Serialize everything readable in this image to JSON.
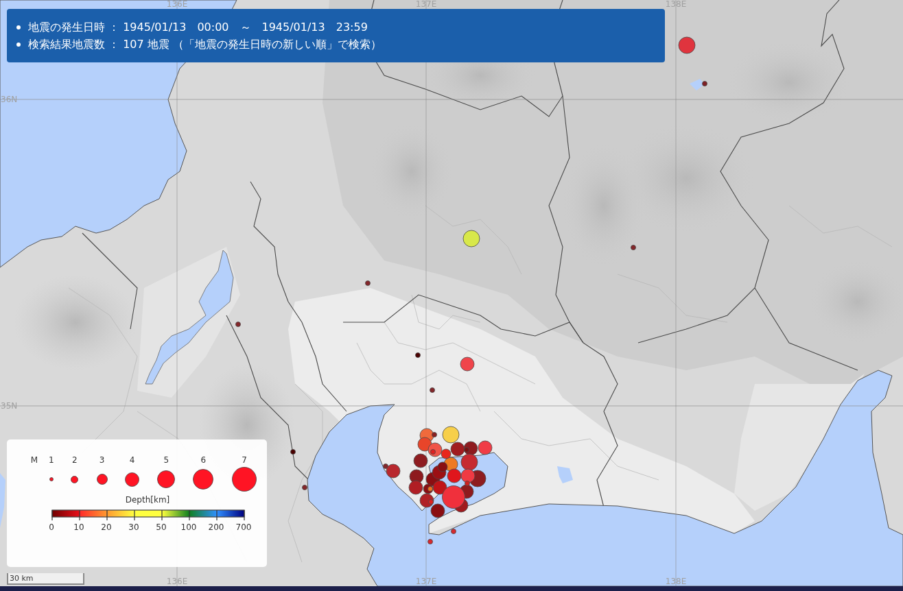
{
  "header": {
    "lines": [
      "地震の発生日時 ： 1945/01/13　00:00　～　1945/01/13　23:59",
      "検索結果地震数 ： 107 地震 （「地震の発生日時の新しい順」で検索）"
    ]
  },
  "map": {
    "longitude_labels_top": [
      "136E",
      "137E",
      "138E"
    ],
    "latitude_labels": [
      "36N",
      "35N"
    ],
    "longitude_labels_bottom": [
      "136E",
      "137E",
      "138E"
    ],
    "quakes": [
      {
        "kind": "m5",
        "color": "#e0343e"
      },
      {
        "kind": "m1",
        "color": "#7e1f24"
      },
      {
        "kind": "m5",
        "color": "#d8e84a"
      },
      {
        "kind": "m1",
        "color": "#84262a"
      },
      {
        "kind": "m1",
        "color": "#84262a"
      },
      {
        "kind": "m1",
        "color": "#84262a"
      },
      {
        "kind": "m1",
        "color": "#4a0000"
      },
      {
        "kind": "m4",
        "color": "#f0454b"
      },
      {
        "kind": "m1",
        "color": "#84262a"
      },
      {
        "kind": "m1",
        "color": "#4a0000"
      },
      {
        "kind": "m1",
        "color": "#84262a"
      },
      {
        "kind": "m1",
        "color": "#84262a"
      },
      {
        "kind": "m1",
        "color": "#d8282e"
      },
      {
        "kind": "m1",
        "color": "#d8282e"
      },
      {
        "kind": "m4",
        "color": "#b8282e"
      },
      {
        "kind": "m4",
        "color": "#f06a3c"
      },
      {
        "kind": "m5",
        "color": "#f7cf4a"
      },
      {
        "kind": "m4",
        "color": "#e8452a"
      },
      {
        "kind": "m4",
        "color": "#f05448"
      },
      {
        "kind": "m4",
        "color": "#8e1c20"
      },
      {
        "kind": "m4",
        "color": "#f03c46"
      },
      {
        "kind": "m4",
        "color": "#8e1a1e"
      },
      {
        "kind": "m4",
        "color": "#a01c20"
      },
      {
        "kind": "m4",
        "color": "#ee7a22"
      },
      {
        "kind": "m5",
        "color": "#c62a30"
      },
      {
        "kind": "m4",
        "color": "#e0161c"
      },
      {
        "kind": "m5",
        "color": "#8e1c20"
      },
      {
        "kind": "m4",
        "color": "#8e1a1e"
      },
      {
        "kind": "m4",
        "color": "#8a0e12"
      },
      {
        "kind": "m4",
        "color": "#f03a44"
      },
      {
        "kind": "m4",
        "color": "#b01e24"
      },
      {
        "kind": "m4",
        "color": "#c01418"
      },
      {
        "kind": "m4",
        "color": "#9c1014"
      },
      {
        "kind": "m3",
        "color": "#8a0e12"
      },
      {
        "kind": "m4",
        "color": "#8e1a1e"
      },
      {
        "kind": "m4",
        "color": "#a01a1e"
      },
      {
        "kind": "m4",
        "color": "#8a0e12"
      },
      {
        "kind": "m4",
        "color": "#b02226"
      },
      {
        "kind": "m7",
        "color": "#f0303c"
      },
      {
        "kind": "m1",
        "color": "#8b2020"
      },
      {
        "kind": "m1",
        "color": "#e02020"
      },
      {
        "kind": "m1",
        "color": "#7a1010"
      },
      {
        "kind": "m1",
        "color": "#d02020"
      },
      {
        "kind": "m1",
        "color": "#f07020"
      },
      {
        "kind": "m1",
        "color": "#e02020"
      },
      {
        "kind": "m3",
        "color": "#8a0e12"
      },
      {
        "kind": "m3",
        "color": "#e8261c"
      }
    ],
    "scale_bar": "30 km"
  },
  "legend": {
    "magnitude_title": "M",
    "magnitudes": [
      "1",
      "2",
      "3",
      "4",
      "5",
      "6",
      "7"
    ],
    "depth_title": "Depth[km]",
    "depth_ticks": [
      "0",
      "10",
      "20",
      "30",
      "50",
      "100",
      "200",
      "700"
    ]
  }
}
